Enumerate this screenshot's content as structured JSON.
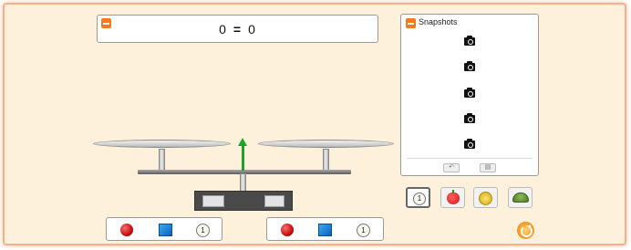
{
  "equation": {
    "left": "0",
    "operator": "=",
    "right": "0"
  },
  "snapshots": {
    "title": "Snapshots",
    "slot_count": 5
  },
  "balance": {
    "tilt": 0
  },
  "left_tray": {
    "items": [
      "red-ball",
      "blue-square",
      "coin"
    ],
    "coin_value": "1"
  },
  "right_tray": {
    "items": [
      "red-ball",
      "blue-square",
      "coin"
    ],
    "coin_value": "1"
  },
  "modes": {
    "coin_value": "1",
    "selected": "coin"
  },
  "colors": {
    "accent": "#f47a22",
    "background": "#fdf1dc",
    "indicator": "#18a72b"
  }
}
